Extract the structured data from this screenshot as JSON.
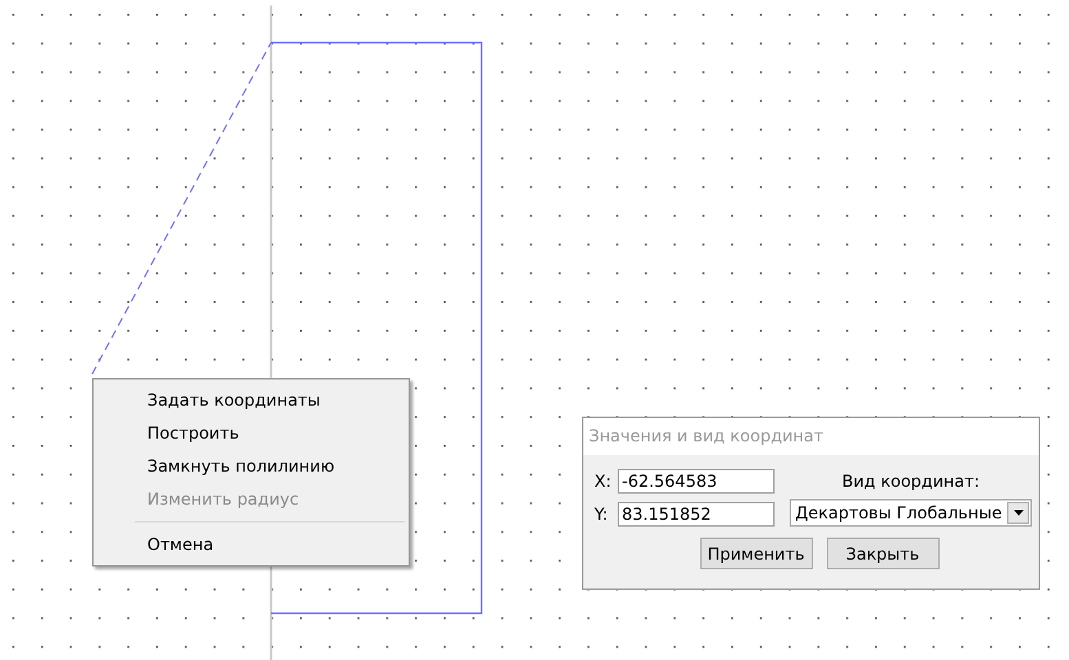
{
  "context_menu": {
    "items": [
      {
        "kind": "item",
        "label": "Задать координаты",
        "disabled": false
      },
      {
        "kind": "item",
        "label": "Построить",
        "disabled": false
      },
      {
        "kind": "item",
        "label": "Замкнуть полилинию",
        "disabled": false
      },
      {
        "kind": "item",
        "label": "Изменить радиус",
        "disabled": true
      },
      {
        "kind": "separator"
      },
      {
        "kind": "item",
        "label": "Отмена",
        "disabled": false
      }
    ]
  },
  "dialog": {
    "title": "Значения и вид координат",
    "fields": [
      {
        "label": "X:",
        "value": "-62.564583"
      },
      {
        "label": "Y:",
        "value": "83.151852"
      }
    ],
    "coordinate_type": {
      "label": "Вид координат:",
      "value": "Декартовы Глобальные"
    },
    "buttons": [
      "Применить",
      "Закрыть"
    ]
  }
}
